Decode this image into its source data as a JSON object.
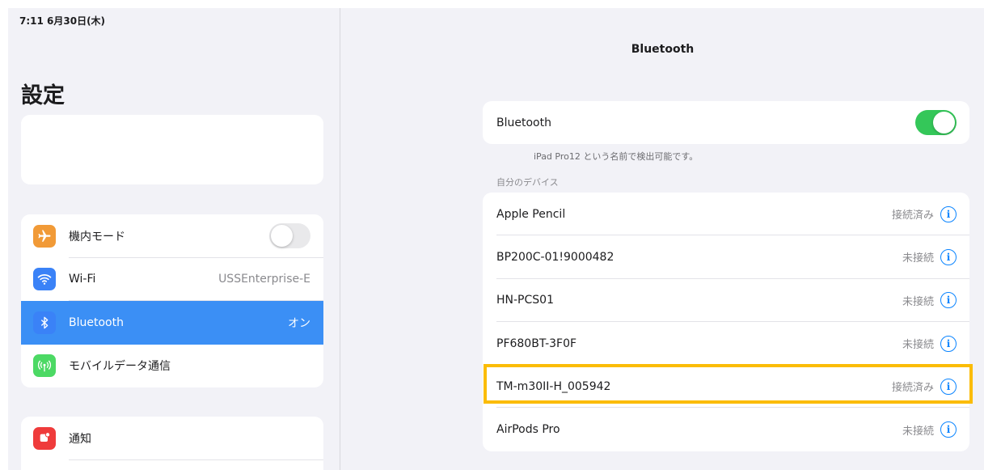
{
  "status_bar": {
    "time": "7:11  6月30日(木)"
  },
  "sidebar": {
    "title": "設定",
    "items": [
      {
        "label": "機内モード",
        "icon": "airplane-icon",
        "icon_color": "#f19a37"
      },
      {
        "label": "Wi-Fi",
        "value": "USSEnterprise-E",
        "icon": "wifi-icon",
        "icon_color": "#3a82f7"
      },
      {
        "label": "Bluetooth",
        "value": "オン",
        "icon": "bluetooth-icon",
        "icon_color": "#3a82f7",
        "active": true
      },
      {
        "label": "モバイルデータ通信",
        "icon": "cellular-icon",
        "icon_color": "#4cd964"
      }
    ],
    "items2": [
      {
        "label": "通知",
        "icon": "notification-icon",
        "icon_color": "#ef3b3b"
      }
    ]
  },
  "detail": {
    "title": "Bluetooth",
    "bluetooth_label": "Bluetooth",
    "discoverable_note": "iPad Pro12 という名前で検出可能です。",
    "section_header": "自分のデバイス",
    "devices": [
      {
        "name": "Apple Pencil",
        "status": "接続済み"
      },
      {
        "name": "BP200C-01!9000482",
        "status": "未接続"
      },
      {
        "name": "HN-PCS01",
        "status": "未接続"
      },
      {
        "name": "PF680BT-3F0F",
        "status": "未接続"
      },
      {
        "name": "TM-m30II-H_005942",
        "status": "接続済み"
      },
      {
        "name": "AirPods Pro",
        "status": "未接続"
      }
    ]
  },
  "colors": {
    "accent": "#3b8ff5",
    "toggle_on": "#34c759",
    "highlight": "#fbbc05"
  }
}
